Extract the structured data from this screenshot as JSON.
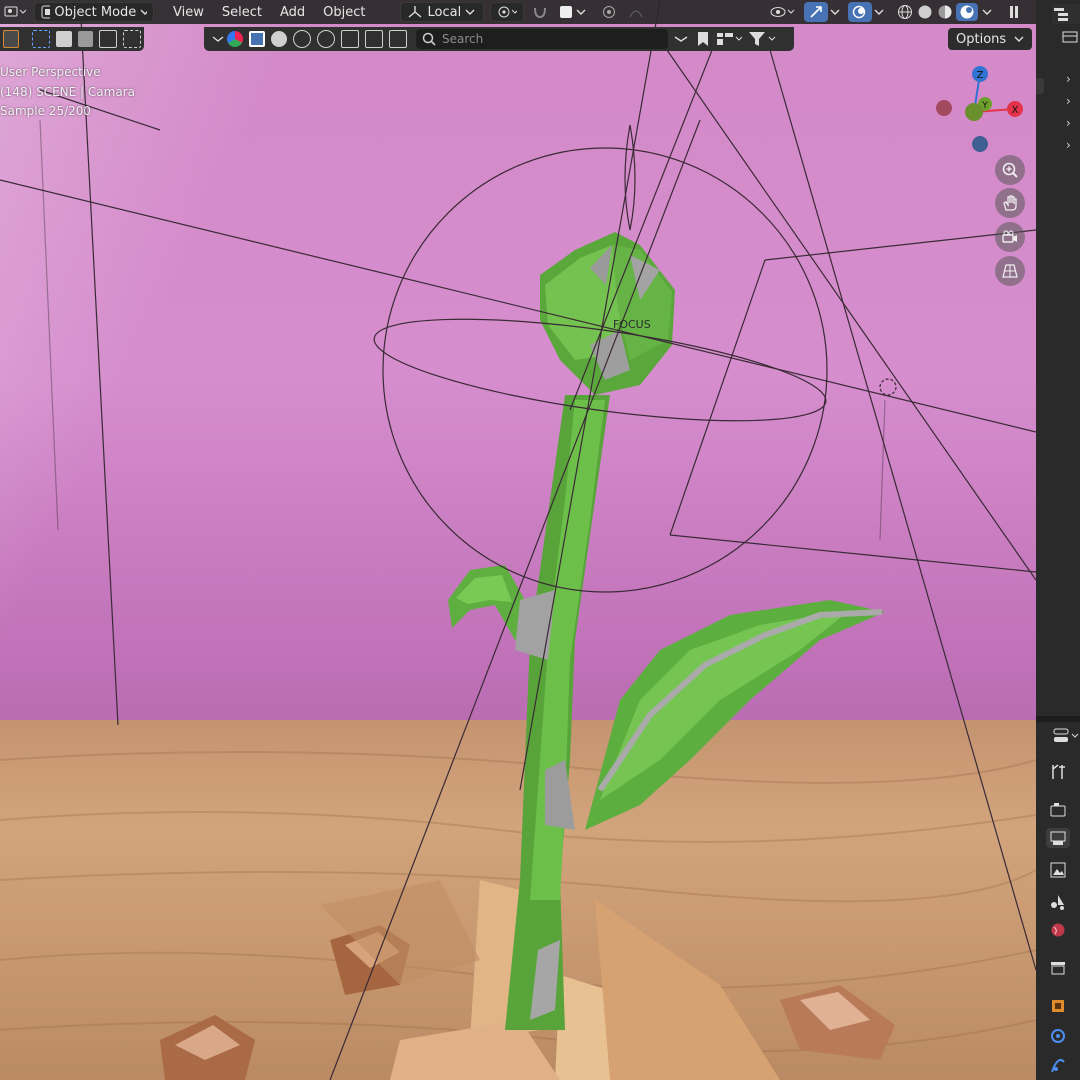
{
  "header": {
    "mode_label": "Object Mode",
    "menus": [
      "View",
      "Select",
      "Add",
      "Object"
    ],
    "transform_orientation": "Local"
  },
  "toolbar": {
    "search_placeholder": "Search",
    "options_label": "Options"
  },
  "viewport_overlay": {
    "perspective": "User Perspective",
    "scene_line": "(148) SCENE | Camara",
    "sample_line": "Sample 25/200",
    "focus_label": "FOCUS"
  },
  "gizmo": {
    "z": "Z",
    "y": "Y",
    "x": "X",
    "colors": {
      "x": "#e4334a",
      "y": "#6da12b",
      "z": "#3173d2"
    }
  },
  "icons": [
    "editor-type-icon",
    "object-mode-icon",
    "pivot-icon",
    "snap-icon",
    "proportional-editing-icon",
    "visibility-icon",
    "gizmo-icon",
    "overlay-icon",
    "wireframe-shading-icon",
    "solid-shading-icon",
    "material-shading-icon",
    "rendered-shading-icon",
    "zoom-icon",
    "hand-icon",
    "camera-view-icon",
    "grid-view-icon",
    "tool-icon",
    "render-icon",
    "output-icon",
    "view-layer-icon",
    "scene-icon",
    "world-icon",
    "collection-icon",
    "object-icon",
    "modifier-icon",
    "particles-icon"
  ]
}
